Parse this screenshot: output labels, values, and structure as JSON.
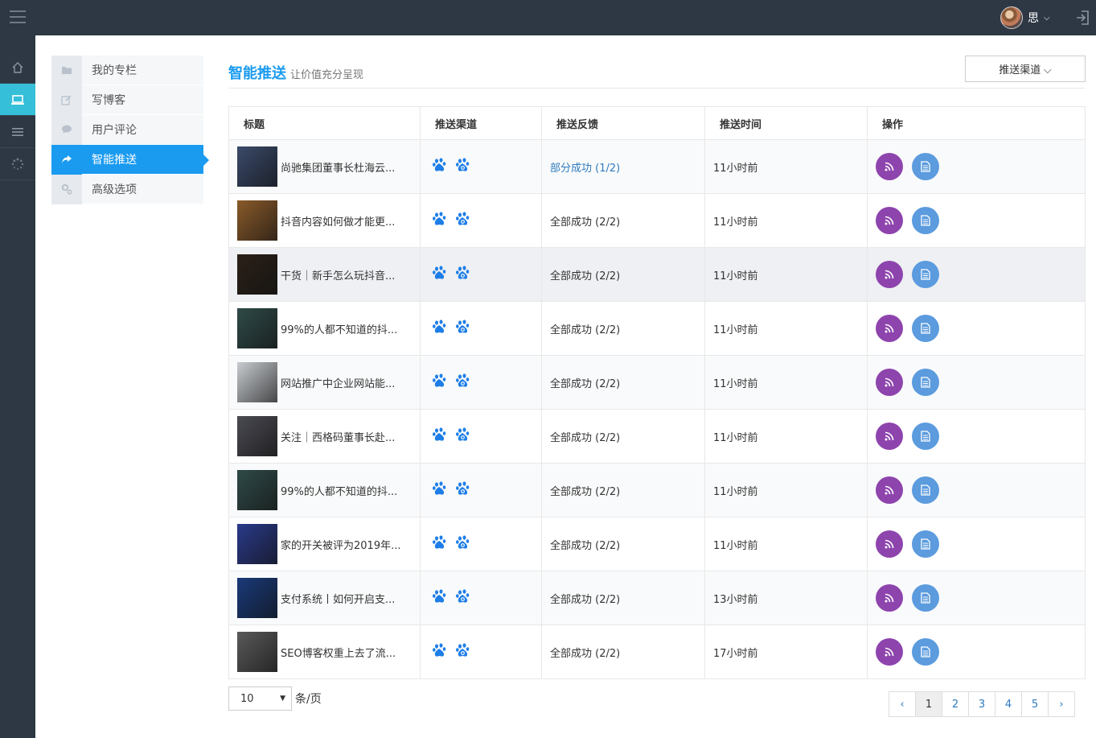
{
  "header": {
    "user_name": "思"
  },
  "sidebar": {
    "items": [
      {
        "label": "我的专栏",
        "icon": "folder-icon"
      },
      {
        "label": "写博客",
        "icon": "edit-icon"
      },
      {
        "label": "用户评论",
        "icon": "comment-icon"
      },
      {
        "label": "智能推送",
        "icon": "share-icon",
        "active": true
      },
      {
        "label": "高级选项",
        "icon": "cogs-icon"
      }
    ]
  },
  "page": {
    "title": "智能推送",
    "subtitle": "让价值充分呈现",
    "channel_button": "推送渠道 ⌵"
  },
  "table": {
    "headers": [
      "标题",
      "推送渠道",
      "推送反馈",
      "推送时间",
      "操作"
    ],
    "rows": [
      {
        "title": "尚驰集团董事长杜海云...",
        "feedback": "部分成功 (1/2)",
        "time": "11小时前",
        "thumb": "#3a4a6a"
      },
      {
        "title": "抖音内容如何做才能更...",
        "feedback": "全部成功 (2/2)",
        "time": "11小时前",
        "thumb": "#8a5a2a"
      },
      {
        "title": "干货｜新手怎么玩抖音...",
        "feedback": "全部成功 (2/2)",
        "time": "11小时前",
        "thumb": "#2a2018"
      },
      {
        "title": "99%的人都不知道的抖...",
        "feedback": "全部成功 (2/2)",
        "time": "11小时前",
        "thumb": "#2f4a48"
      },
      {
        "title": "网站推广中企业网站能...",
        "feedback": "全部成功 (2/2)",
        "time": "11小时前",
        "thumb": "#c8ccd0"
      },
      {
        "title": "关注｜西格码董事长赴...",
        "feedback": "全部成功 (2/2)",
        "time": "11小时前",
        "thumb": "#4a4a52"
      },
      {
        "title": "99%的人都不知道的抖...",
        "feedback": "全部成功 (2/2)",
        "time": "11小时前",
        "thumb": "#2f4a48"
      },
      {
        "title": "家的开关被评为2019年...",
        "feedback": "全部成功 (2/2)",
        "time": "11小时前",
        "thumb": "#2a3a8a"
      },
      {
        "title": "支付系统丨如何开启支...",
        "feedback": "全部成功 (2/2)",
        "time": "13小时前",
        "thumb": "#1a3a7a"
      },
      {
        "title": "SEO博客权重上去了流...",
        "feedback": "全部成功 (2/2)",
        "time": "17小时前",
        "thumb": "#5a5a5a"
      }
    ]
  },
  "pagination": {
    "page_size": "10",
    "unit": "条/页",
    "prev": "‹",
    "next": "›",
    "pages": [
      "1",
      "2",
      "3",
      "4",
      "5"
    ],
    "current": "1"
  },
  "colors": {
    "accent": "#1a9bf0",
    "topbar": "#2e3844",
    "rss": "#8e44ad",
    "doc": "#5b9bde",
    "baidu": "#1e7ee8"
  }
}
